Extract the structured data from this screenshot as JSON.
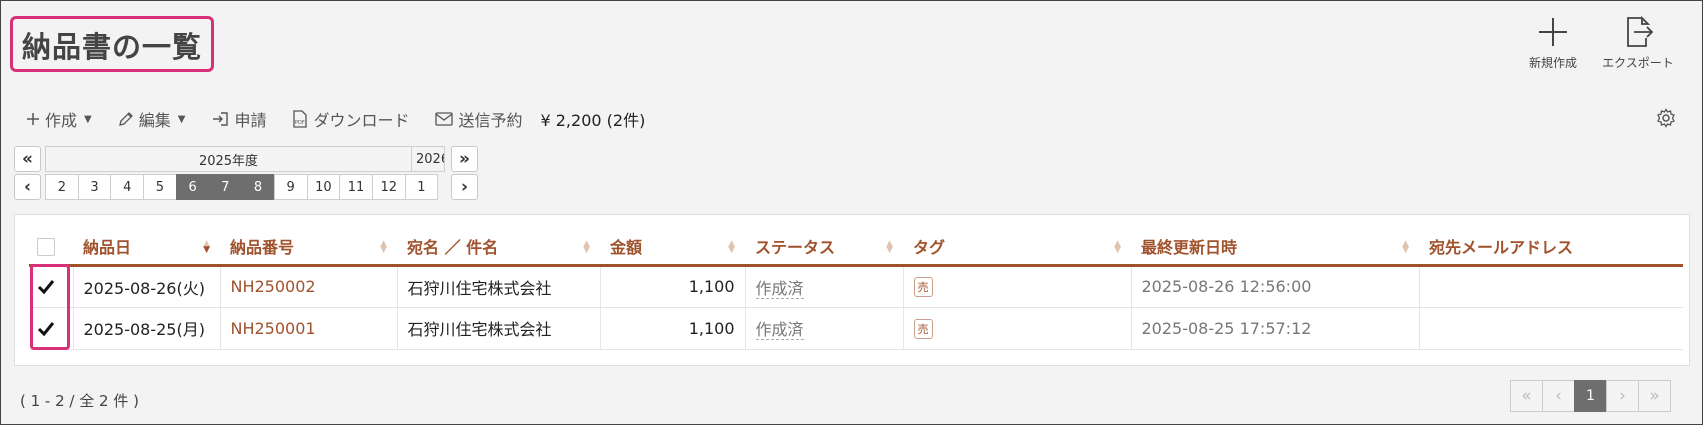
{
  "header": {
    "title": "納品書の一覧",
    "actions": [
      {
        "label": "新規作成",
        "icon": "plus-icon"
      },
      {
        "label": "エクスポート",
        "icon": "export-icon"
      }
    ]
  },
  "toolbar": {
    "create_label": "作成",
    "edit_label": "編集",
    "apply_label": "申請",
    "download_label": "ダウンロード",
    "schedule_label": "送信予約",
    "total_label": "¥ 2,200 (2件)"
  },
  "period_nav": {
    "fy_current": "2025年度",
    "fy_next": "2026",
    "months": [
      "2",
      "3",
      "4",
      "5",
      "6",
      "7",
      "8",
      "9",
      "10",
      "11",
      "12",
      "1"
    ],
    "selected_months": [
      "6",
      "7",
      "8"
    ]
  },
  "table": {
    "columns": [
      "納品日",
      "納品番号",
      "宛名 ／ 件名",
      "金額",
      "ステータス",
      "タグ",
      "最終更新日時",
      "宛先メールアドレス"
    ],
    "rows": [
      {
        "checked": true,
        "date": "2025-08-26(火)",
        "number": "NH250002",
        "recipient": "石狩川住宅株式会社",
        "amount": "1,100",
        "status": "作成済",
        "tag": "売",
        "updated": "2025-08-26 12:56:00",
        "email": ""
      },
      {
        "checked": true,
        "date": "2025-08-25(月)",
        "number": "NH250001",
        "recipient": "石狩川住宅株式会社",
        "amount": "1,100",
        "status": "作成済",
        "tag": "売",
        "updated": "2025-08-25 17:57:12",
        "email": ""
      }
    ]
  },
  "footer": {
    "count_text": "( 1 - 2 / 全 2 件 )",
    "current_page": "1"
  },
  "colors": {
    "accent": "#a0522d",
    "highlight": "#d9307a",
    "selected_month": "#6e6e6e"
  }
}
